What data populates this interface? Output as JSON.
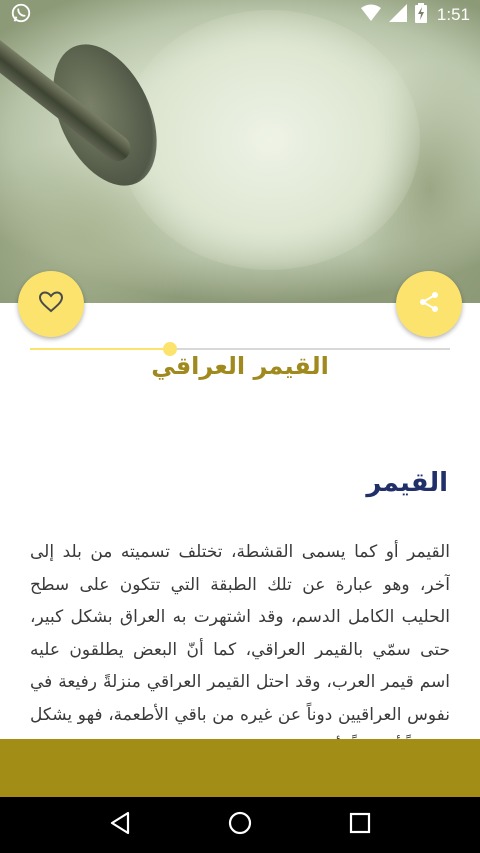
{
  "status_bar": {
    "time": "1:51",
    "icons": [
      "whatsapp-icon",
      "wifi-icon",
      "signal-icon",
      "battery-charging-icon"
    ]
  },
  "hero": {
    "image_alt": "qeymar-photo"
  },
  "actions": {
    "favorite_icon": "heart-outline-icon",
    "share_icon": "share-icon",
    "accent_color": "#fbe36d"
  },
  "recipe": {
    "title": "القيمر العراقي",
    "title_color": "#a08a1e"
  },
  "section": {
    "heading": "القيمر",
    "heading_color": "#22306a",
    "body": "القيمر أو كما يسمى القشطة، تختلف تسميته من بلد إلى آخر، وهو عبارة عن تلك الطبقة التي تتكون على سطح الحليب الكامل الدسم، وقد اشتهرت به العراق بشكل كبير، حتى سمّي بالقيمر العراقي، كما أنّ البعض يطلقون عليه اسم قيمر العرب، وقد احتل القيمر العراقي منزلةً رفيعة في نفوس العراقيين دوناً عن غيره من باقي الأطعمة، فهو يشكل فطوراً أساسياً لأفراد العائلات العراقية والضيوف"
  },
  "bottom_bar": {
    "color": "#a28d16"
  },
  "nav": {
    "back_icon": "back-triangle-icon",
    "home_icon": "home-circle-icon",
    "recents_icon": "recents-square-icon"
  }
}
